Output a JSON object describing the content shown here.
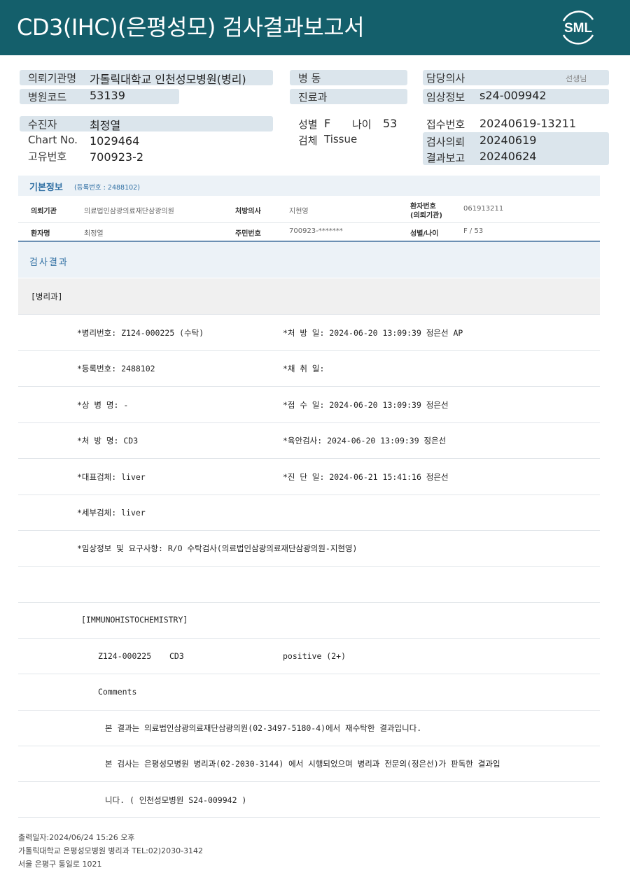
{
  "header": {
    "title": "CD3(IHC)(은평성모) 검사결과보고서",
    "logo_text": "SML"
  },
  "patient_info": {
    "requester_label": "의뢰기관명",
    "requester_value": "가톨릭대학교 인천성모병원(병리)",
    "hospital_code_label": "병원코드",
    "hospital_code_value": "53139",
    "ward_label": "병 동",
    "department_label": "진료과",
    "doctor_label": "담당의사",
    "doctor_suffix": "선생님",
    "clinical_label": "임상정보",
    "clinical_value": "s24-009942",
    "patient_label": "수진자",
    "patient_value": "최정열",
    "chart_label": "Chart No.",
    "chart_value": "1029464",
    "unique_label": "고유번호",
    "unique_value": "700923-2",
    "sex_label": "성별",
    "sex_value": "F",
    "age_label": "나이",
    "age_value": "53",
    "specimen_label": "검체",
    "specimen_value": "Tissue",
    "receipt_label": "접수번호",
    "receipt_value": "20240619-13211",
    "request_label": "검사의뢰",
    "request_value": "20240619",
    "report_label": "결과보고",
    "report_value": "20240624"
  },
  "basic_info": {
    "title": "기본정보",
    "reg_note": "(등록번호 : 2488102)",
    "institution_label": "의뢰기관",
    "institution_value": "의료법인삼광의료재단삼광의원",
    "prescriber_label": "처방의사",
    "prescriber_value": "지현영",
    "patient_no_label": "환자번호",
    "patient_no_sub": "(의뢰기관)",
    "patient_no_value": "061913211",
    "name_label": "환자명",
    "name_value": "최정열",
    "rrn_label": "주민번호",
    "rrn_value": "700923-*******",
    "sexage_label": "성별/나이",
    "sexage_value": "F / 53"
  },
  "results": {
    "title": "검사결과",
    "section": "[병리과]",
    "rows": [
      {
        "left": "*병리번호: Z124-000225 (수탁)",
        "right": "*처 방 일: 2024-06-20 13:09:39  정은선 AP"
      },
      {
        "left": "*등록번호: 2488102",
        "right": "*채 취 일:"
      },
      {
        "left": "*상 병 명: -",
        "right": "*접 수 일: 2024-06-20 13:09:39  정은선"
      },
      {
        "left": "*처 방 명: CD3",
        "right": "*육안검사: 2024-06-20 13:09:39  정은선"
      },
      {
        "left": "*대표검체: liver",
        "right": "*진 단 일: 2024-06-21 15:41:16  정은선"
      },
      {
        "left": "*세부검체: liver",
        "right": ""
      },
      {
        "left": "*임상정보 및 요구사항: R/O 수탁검사(의료법인삼광의료재단삼광의원-지현영)",
        "right": ""
      }
    ],
    "ihc_title": "[IMMUNOHISTOCHEMISTRY]",
    "ihc_id": "Z124-000225",
    "ihc_marker": "CD3",
    "ihc_result": "positive (2+)",
    "comments_label": "Comments",
    "comment_1": "본 결과는 의료법인삼광의료재단삼광의원(02-3497-5180-4)에서 재수탁한 결과입니다.",
    "comment_2": "본 검사는 은평성모병원 병리과(02-2030-3144) 에서 시행되었으며 병리과 전문의(정은선)가 판독한 결과입",
    "comment_3": "니다. ( 인천성모병원 S24-009942 )"
  },
  "footer": {
    "line1": "출력일자:2024/06/24 15:26 오후",
    "line2": "가톨릭대학교 은평성모병원 병리과 TEL:02)2030-3142",
    "line3": "서울 은평구 통일로 1021"
  },
  "colors": {
    "header_bg": "#145f6b",
    "pill_bg": "#dbe5ec",
    "section_bg": "#ecf2f7",
    "accent_blue": "#2f6fa3"
  }
}
